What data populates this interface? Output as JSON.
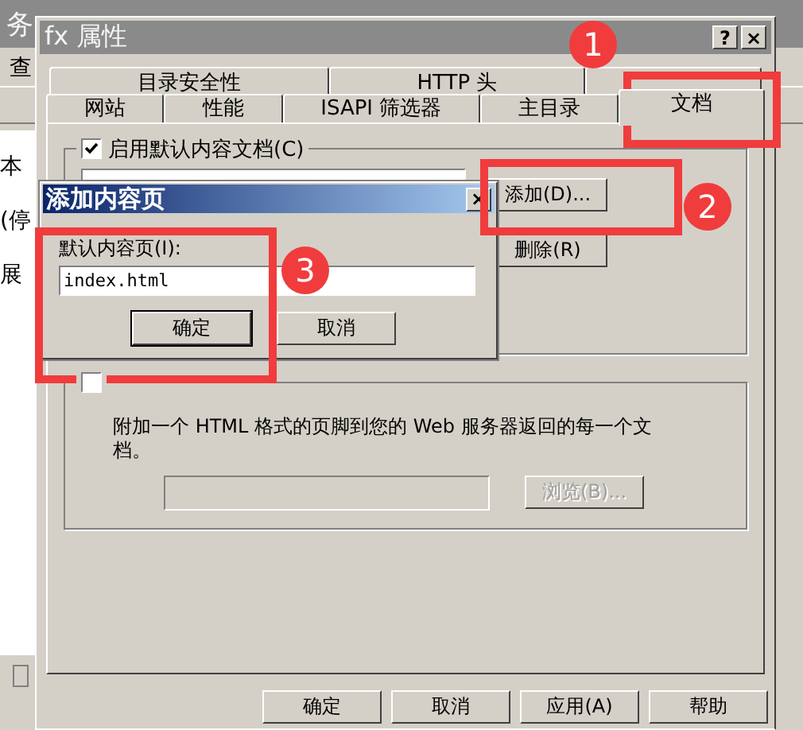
{
  "background_window": {
    "title": "务",
    "menu": [
      "查"
    ],
    "side_texts": [
      "本",
      "(停",
      "展"
    ]
  },
  "dialog": {
    "title": "fx 属性",
    "title_buttons": [
      "?",
      "×"
    ],
    "tab_rows": [
      [
        {
          "label": "目录安全性",
          "selected": false
        },
        {
          "label": "HTTP 头",
          "selected": false
        },
        {
          "selected": false
        }
      ],
      [
        {
          "label": "网站",
          "selected": false
        },
        {
          "label": "性能",
          "selected": false
        },
        {
          "label": "ISAPI 筛选器",
          "selected": false
        },
        {
          "label": "主目录",
          "selected": false
        },
        {
          "label": "文档",
          "selected": true
        }
      ]
    ],
    "default_docs": {
      "label": "启用默认内容文档(C)",
      "checked": true,
      "buttons": [
        {
          "label": "添加(D)...",
          "disabled": false
        },
        {
          "label": "删除(R)",
          "disabled": false
        }
      ]
    },
    "footer": {
      "checked": false,
      "description": "附加一个 HTML 格式的页脚到您的 Web 服务器返回的每一个文档。",
      "browse": {
        "label": "浏览(B)...",
        "disabled": true
      }
    },
    "buttons": [
      "确定",
      "取消",
      "应用(A)",
      "帮助"
    ]
  },
  "modal": {
    "title": "添加内容页",
    "close": "×",
    "field_label": "默认内容页(I):",
    "value": "index.html",
    "buttons": [
      "确定",
      "取消"
    ]
  },
  "annotations": [
    {
      "number": "1"
    },
    {
      "number": "2"
    },
    {
      "number": "3"
    }
  ]
}
